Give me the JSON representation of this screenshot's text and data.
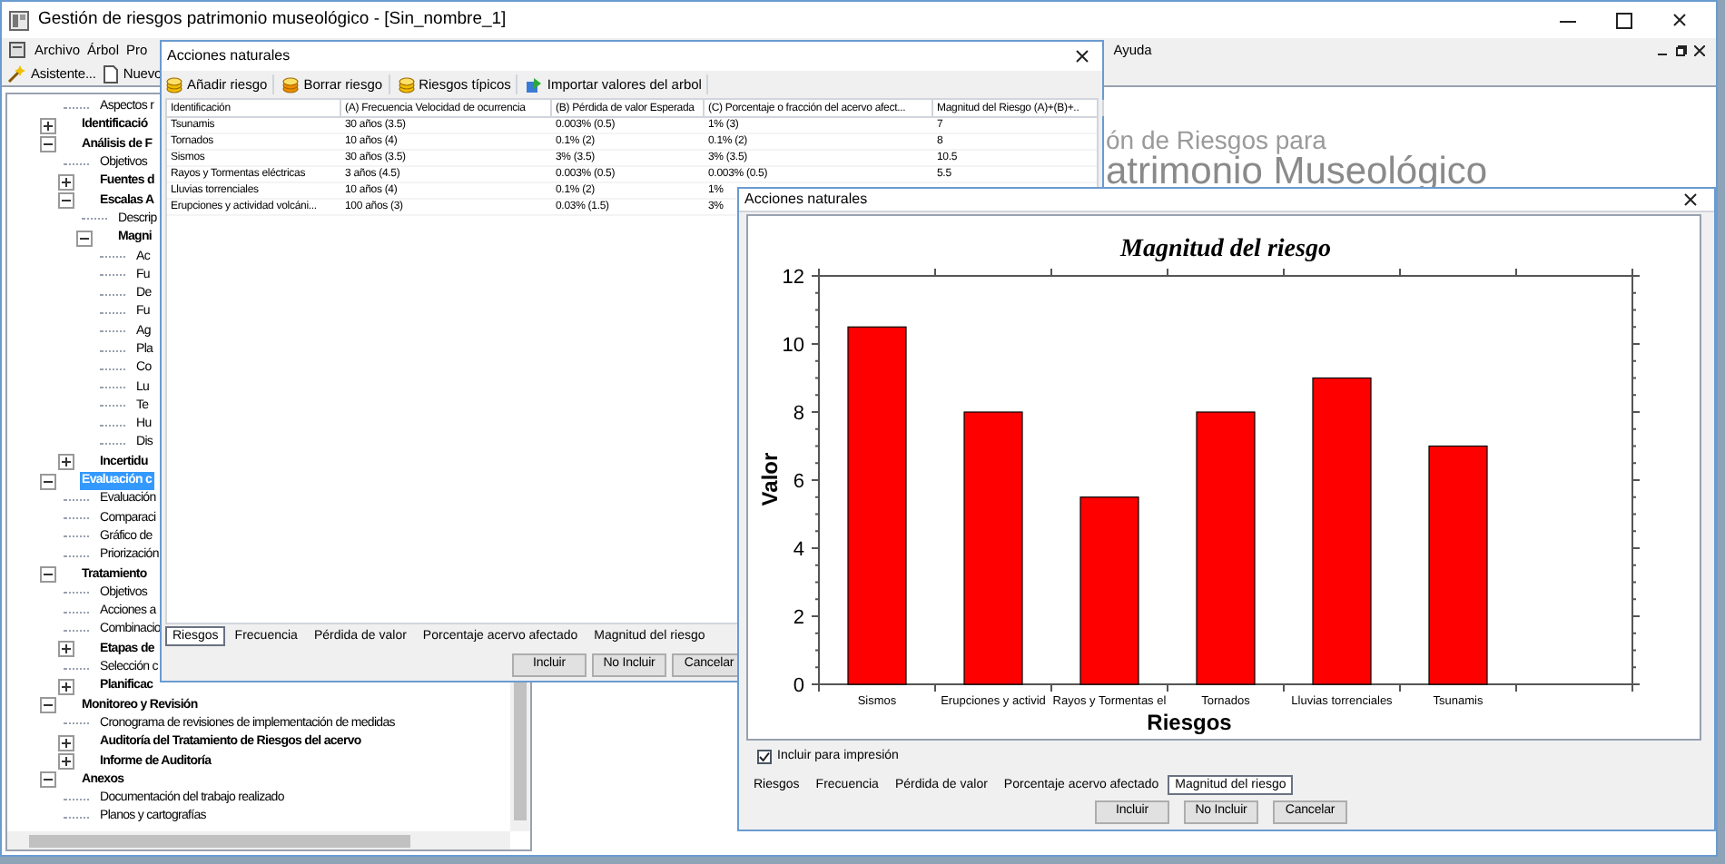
{
  "main_window": {
    "title": "Gestión de riesgos patrimonio museológico - [Sin_nombre_1]",
    "menu_left": [
      "Archivo",
      "Árbol",
      "Pro"
    ],
    "menu_right": [
      "Ayuda"
    ],
    "toolbar": [
      "Asistente...",
      "Nuevo"
    ],
    "tree": {
      "continued_items": [
        {
          "label": "Aspectos r",
          "selected": false
        }
      ],
      "items": [
        {
          "label": "Identificació",
          "expanded": false,
          "selected": false
        },
        {
          "label": "Análisis de F",
          "expanded": true,
          "selected": false,
          "children": [
            {
              "label": "Objetivos",
              "selected": false
            },
            {
              "label": "Fuentes d",
              "expanded": false,
              "selected": false
            },
            {
              "label": "Escalas A",
              "expanded": true,
              "selected": false,
              "children": [
                {
                  "label": "Descrip",
                  "selected": false
                },
                {
                  "label": "Magni",
                  "expanded": true,
                  "selected": false,
                  "children": [
                    {
                      "label": "Ac",
                      "selected": false
                    },
                    {
                      "label": "Fu",
                      "selected": false
                    },
                    {
                      "label": "De",
                      "selected": false
                    },
                    {
                      "label": "Fu",
                      "selected": false
                    },
                    {
                      "label": "Ag",
                      "selected": false
                    },
                    {
                      "label": "Pla",
                      "selected": false
                    },
                    {
                      "label": "Co",
                      "selected": false
                    },
                    {
                      "label": "Lu",
                      "selected": false
                    },
                    {
                      "label": "Te",
                      "selected": false
                    },
                    {
                      "label": "Hu",
                      "selected": false
                    },
                    {
                      "label": "Dis",
                      "selected": false
                    }
                  ]
                }
              ]
            },
            {
              "label": "Incertidu",
              "expanded": false,
              "selected": false
            }
          ]
        },
        {
          "label": "Evaluación c",
          "expanded": true,
          "selected": true,
          "children": [
            {
              "label": "Evaluación",
              "selected": false
            },
            {
              "label": "Comparaci",
              "selected": false
            },
            {
              "label": "Gráfico de",
              "selected": false
            },
            {
              "label": "Priorización",
              "selected": false
            }
          ]
        },
        {
          "label": "Tratamiento",
          "expanded": true,
          "selected": false,
          "children": [
            {
              "label": "Objetivos",
              "selected": false
            },
            {
              "label": "Acciones a",
              "selected": false
            },
            {
              "label": "Combinacio",
              "selected": false
            },
            {
              "label": "Etapas de",
              "expanded": false,
              "selected": false
            },
            {
              "label": "Selección c",
              "selected": false
            },
            {
              "label": "Planificac",
              "expanded": false,
              "selected": false
            }
          ]
        },
        {
          "label": "Monitoreo y Revisión",
          "expanded": true,
          "selected": false,
          "children": [
            {
              "label": "Cronograma de revisiones de implementación de medidas",
              "selected": false
            },
            {
              "label": "Auditoría del Tratamiento de Riesgos del acervo",
              "expanded": false,
              "selected": false
            },
            {
              "label": "Informe de Auditoría",
              "expanded": false,
              "selected": false
            }
          ]
        },
        {
          "label": "Anexos",
          "expanded": true,
          "selected": false,
          "children": [
            {
              "label": "Documentación del trabajo realizado",
              "selected": false
            },
            {
              "label": "Planos y cartografías",
              "selected": false
            }
          ]
        }
      ]
    },
    "logo": {
      "line_1": "ón de Riesgos para",
      "line_2": "atrimonio Museológico"
    }
  },
  "dialog_1": {
    "title": "Acciones naturales",
    "toolbar": [
      "Añadir riesgo",
      "Borrar riesgo",
      "Riesgos típicos",
      "Importar valores del arbol"
    ],
    "table": {
      "columns": [
        "Identificación",
        "(A) Frecuencia Velocidad de ocurrencia",
        "(B) Pérdida de valor Esperada",
        "(C) Porcentaje o fracción del acervo afect...",
        "Magnitud del  Riesgo (A)+(B)+.."
      ],
      "rows": [
        {
          "cells": [
            "Tsunamis",
            "30 años (3.5)",
            "0.003% (0.5)",
            "1% (3)",
            "7"
          ]
        },
        {
          "cells": [
            "Tornados",
            "10 años (4)",
            "0.1% (2)",
            "0.1% (2)",
            "8"
          ]
        },
        {
          "cells": [
            "Sismos",
            "30 años (3.5)",
            "3% (3.5)",
            "3% (3.5)",
            "10.5"
          ]
        },
        {
          "cells": [
            "Rayos y Tormentas eléctricas",
            "3 años (4.5)",
            "0.003% (0.5)",
            "0.003% (0.5)",
            "5.5"
          ]
        },
        {
          "cells": [
            "Lluvias torrenciales",
            "10 años (4)",
            "0.1% (2)",
            "1%"
          ]
        },
        {
          "cells": [
            "Erupciones y actividad volcáni...",
            "100 años (3)",
            "0.03% (1.5)",
            "3%"
          ]
        }
      ]
    },
    "tabs": [
      {
        "label": "Riesgos",
        "selected": true
      },
      {
        "label": "Frecuencia",
        "selected": false
      },
      {
        "label": "Pérdida de valor",
        "selected": false
      },
      {
        "label": "Porcentaje acervo afectado",
        "selected": false
      },
      {
        "label": "Magnitud del riesgo",
        "selected": false
      }
    ],
    "buttons": [
      "Incluir",
      "No Incluir",
      "Cancelar"
    ]
  },
  "dialog_2": {
    "title": "Acciones naturales",
    "chart_data": {
      "type": "bar",
      "title": "Magnitud del riesgo",
      "xlabel": "Riesgos",
      "ylabel": "Valor",
      "categories": [
        "Sismos",
        "Erupciones y activid",
        "Rayos y Tormentas el",
        "Tornados",
        "Lluvias torrenciales",
        "Tsunamis"
      ],
      "values": [
        10.5,
        8,
        5.5,
        8,
        9,
        7
      ],
      "ylim": [
        0,
        12
      ],
      "yticks": [
        0,
        2,
        4,
        6,
        8,
        10,
        12
      ]
    },
    "include_print": {
      "label": "Incluir para impresión",
      "checked": true
    },
    "tabs": [
      {
        "label": "Riesgos",
        "selected": false
      },
      {
        "label": "Frecuencia",
        "selected": false
      },
      {
        "label": "Pérdida de valor",
        "selected": false
      },
      {
        "label": "Porcentaje acervo afectado",
        "selected": false
      },
      {
        "label": "Magnitud del riesgo",
        "selected": true
      }
    ],
    "buttons": [
      "Incluir",
      "No Incluir",
      "Cancelar"
    ]
  }
}
